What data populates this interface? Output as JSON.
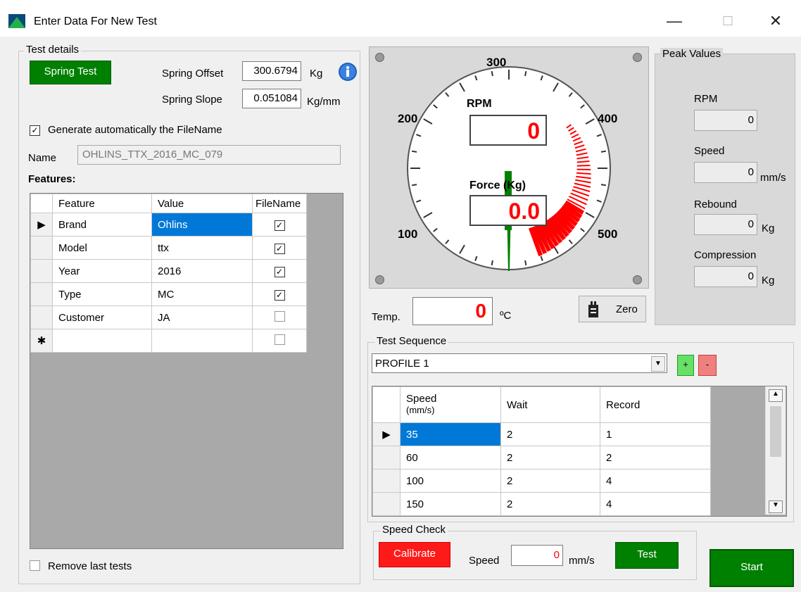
{
  "window": {
    "title": "Enter Data For New Test",
    "minimize": "—",
    "maximize": "☐",
    "close": "✕"
  },
  "test_details": {
    "group_label": "Test details",
    "spring_test_btn": "Spring Test",
    "spring_offset_label": "Spring Offset",
    "spring_offset_value": "300.6794",
    "spring_offset_unit": "Kg",
    "spring_slope_label": "Spring Slope",
    "spring_slope_value": "0.051084",
    "spring_slope_unit": "Kg/mm",
    "auto_filename_label": "Generate automatically the FileName",
    "auto_filename_checked": true,
    "name_label": "Name",
    "name_value": "OHLINS_TTX_2016_MC_079",
    "features_label": "Features:",
    "remove_last_label": "Remove last tests"
  },
  "features": {
    "headers": [
      "Feature",
      "Value",
      "FileName"
    ],
    "rows": [
      {
        "feature": "Brand",
        "value": "Ohlins",
        "filename": true
      },
      {
        "feature": "Model",
        "value": "ttx",
        "filename": true
      },
      {
        "feature": "Year",
        "value": "2016",
        "filename": true
      },
      {
        "feature": "Type",
        "value": "MC",
        "filename": true
      },
      {
        "feature": "Customer",
        "value": "JA",
        "filename": false
      }
    ],
    "new_row_marker": "✱"
  },
  "gauge": {
    "tick_labels": {
      "t100": "100",
      "t200": "200",
      "t300": "300",
      "t400": "400",
      "t500": "500"
    },
    "rpm_label": "RPM",
    "rpm_value": "0",
    "force_label": "Force (Kg)",
    "force_value": "0.0",
    "temp_label": "Temp.",
    "temp_value": "0",
    "temp_unit": "ºC",
    "zero_btn": "Zero",
    "accent_red": "#ff0000",
    "needle_green": "#008000"
  },
  "peak": {
    "group_label": "Peak Values",
    "rpm_label": "RPM",
    "rpm_value": "0",
    "speed_label": "Speed",
    "speed_value": "0",
    "speed_unit": "mm/s",
    "rebound_label": "Rebound",
    "rebound_value": "0",
    "rebound_unit": "Kg",
    "compression_label": "Compression",
    "compression_value": "0",
    "compression_unit": "Kg"
  },
  "sequence": {
    "group_label": "Test Sequence",
    "profile": "PROFILE 1",
    "add_btn": "+",
    "remove_btn": "-",
    "headers": {
      "speed": "Speed",
      "speed_unit": "(mm/s)",
      "wait": "Wait",
      "record": "Record"
    },
    "rows": [
      {
        "speed": "35",
        "wait": "2",
        "record": "1"
      },
      {
        "speed": "60",
        "wait": "2",
        "record": "2"
      },
      {
        "speed": "100",
        "wait": "2",
        "record": "4"
      },
      {
        "speed": "150",
        "wait": "2",
        "record": "4"
      }
    ]
  },
  "speed_check": {
    "group_label": "Speed Check",
    "calibrate_btn": "Calibrate",
    "speed_label": "Speed",
    "speed_value": "0",
    "speed_unit": "mm/s",
    "test_btn": "Test"
  },
  "start_btn": "Start"
}
